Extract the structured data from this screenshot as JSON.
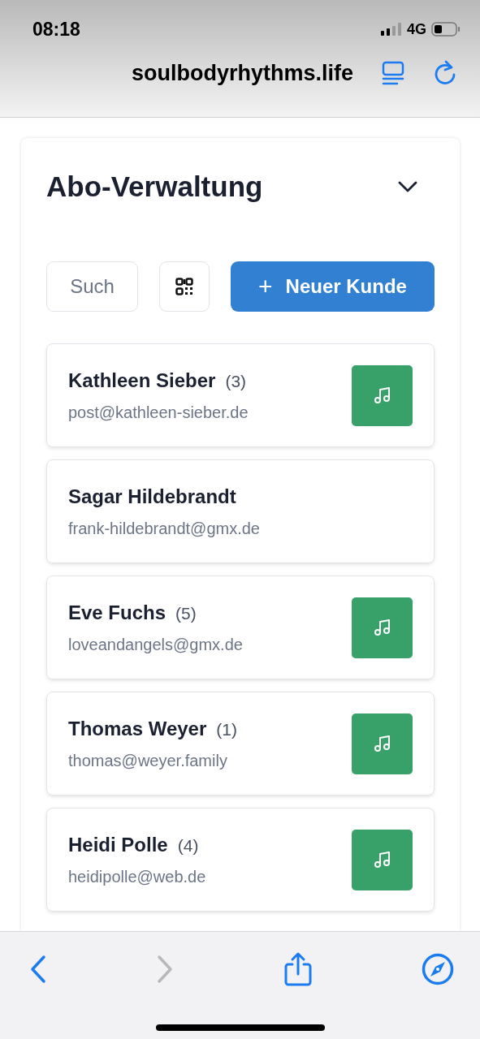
{
  "status_bar": {
    "time": "08:18",
    "network": "4G"
  },
  "browser": {
    "url": "soulbodyrhythms.life",
    "back_disabled": false,
    "forward_disabled": true
  },
  "panel": {
    "title": "Abo-Verwaltung",
    "expanded": true,
    "search": {
      "placeholder": "Such"
    },
    "new_button": {
      "icon": "+",
      "label": "Neuer Kunde"
    },
    "customers": [
      {
        "name": "Kathleen Sieber",
        "count": "(3)",
        "email": "post@kathleen-sieber.de",
        "music": true
      },
      {
        "name": "Sagar Hildebrandt",
        "email": "frank-hildebrandt@gmx.de",
        "music": false
      },
      {
        "name": "Eve Fuchs",
        "count": "(5)",
        "email": "loveandangels@gmx.de",
        "music": true
      },
      {
        "name": "Thomas Weyer",
        "count": "(1)",
        "email": "thomas@weyer.family",
        "music": true
      },
      {
        "name": "Heidi Polle",
        "count": "(4)",
        "email": "heidipolle@web.de",
        "music": true
      }
    ]
  }
}
